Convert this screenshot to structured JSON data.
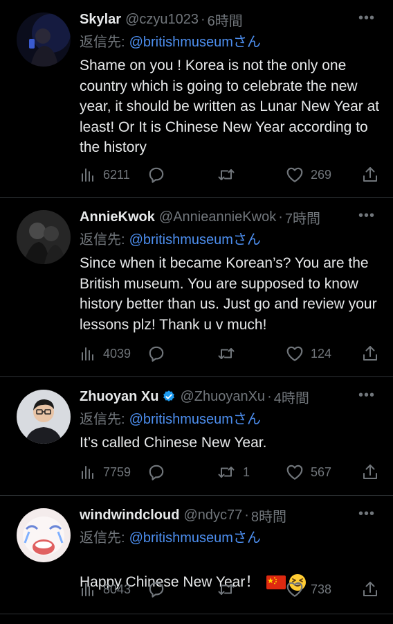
{
  "reply_prefix": "返信先:",
  "san_suffix": "さん",
  "more_label": "•••",
  "colors": {
    "background": "#000000",
    "text": "#e7e9ea",
    "muted": "#71767b",
    "link": "#4d8ff0",
    "verified": "#1d9bf0"
  },
  "tweets": [
    {
      "name": "Skylar",
      "handle": "@czyu1023",
      "time": "6時間",
      "mention": "@britishmuseum",
      "text": "Shame on you ! Korea is not the only one country which is going to celebrate the new year, it should be written as Lunar New Year at least! Or It is Chinese New Year according to the history",
      "views": "6211",
      "retweets": "",
      "likes": "269",
      "icons": [
        "views-icon",
        "reply-icon",
        "retweet-icon",
        "like-icon",
        "share-icon"
      ]
    },
    {
      "name": "AnnieKwok",
      "handle": "@AnnieannieKwok",
      "time": "7時間",
      "mention": "@britishmuseum",
      "text": "Since when it became Korean’s? You are the British museum. You are supposed to know history better than us. Just go and review your lessons plz! Thank u v much!",
      "views": "4039",
      "retweets": "",
      "likes": "124"
    },
    {
      "name": "Zhuoyan Xu",
      "handle": "@ZhuoyanXu",
      "time": "4時間",
      "verified": true,
      "mention": "@britishmuseum",
      "text": "It’s called Chinese New Year.",
      "views": "7759",
      "retweets": "1",
      "likes": "567"
    },
    {
      "name": "windwindcloud",
      "handle": "@ndyc77",
      "time": "8時間",
      "mention": "@britishmuseum",
      "text": "Happy Chinese New Year！",
      "text_emojis": [
        "china-flag-emoji",
        "grinning-squinting-face-emoji"
      ],
      "views": "8043",
      "retweets": "",
      "likes": "738"
    }
  ]
}
